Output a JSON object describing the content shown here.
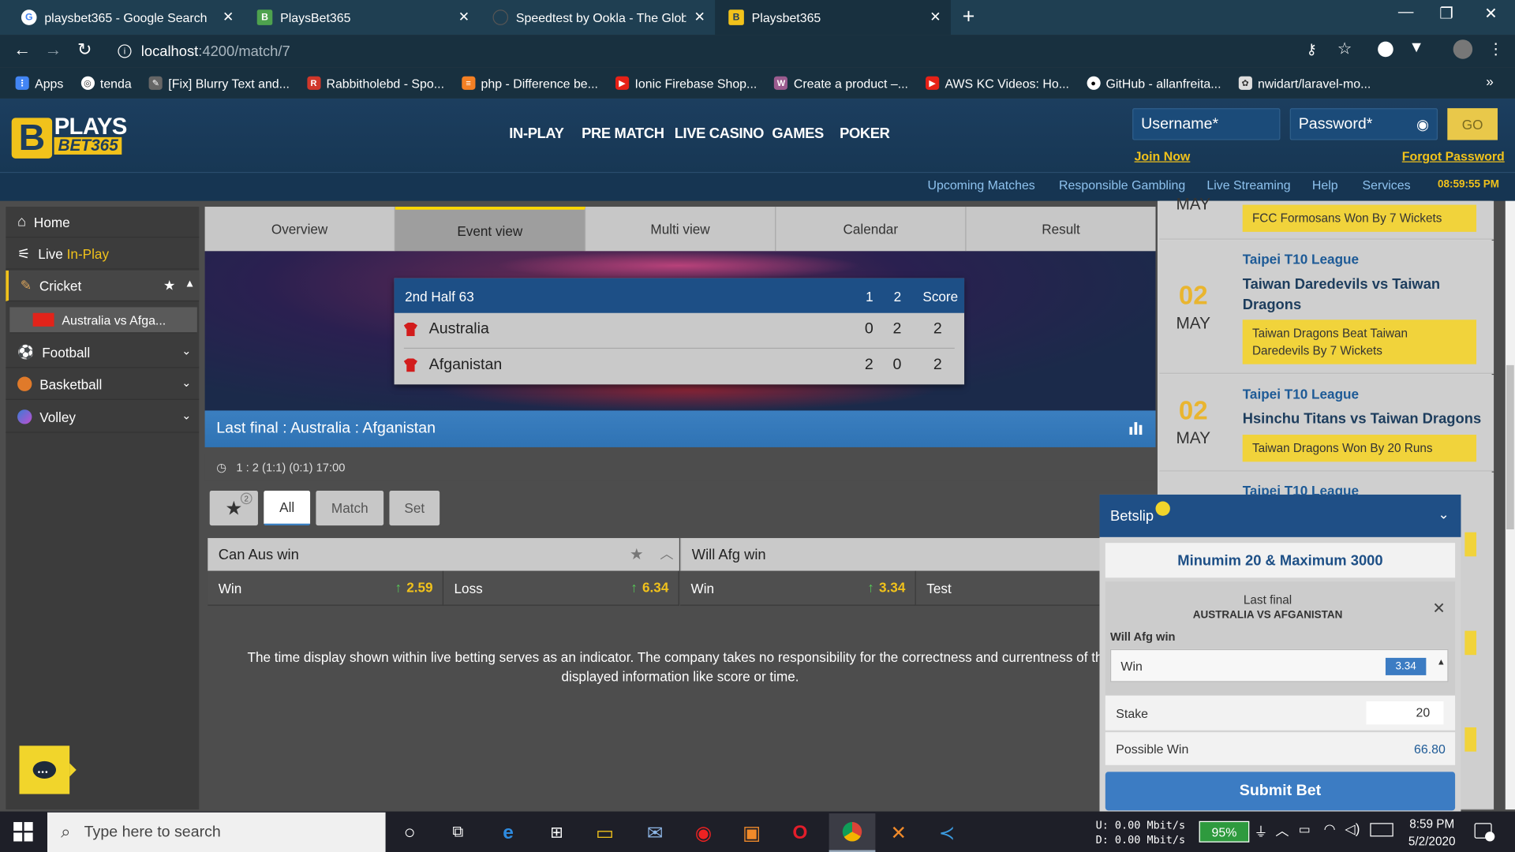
{
  "browser": {
    "tabs": [
      {
        "title": "playsbet365 - Google Search",
        "icon": "google-icon"
      },
      {
        "title": "PlaysBet365",
        "icon": "site-icon"
      },
      {
        "title": "Speedtest by Ookla - The Global",
        "icon": "speedtest-icon"
      },
      {
        "title": "Playsbet365",
        "icon": "playsbet-icon"
      }
    ],
    "url_host": "localhost",
    "url_path": ":4200/match/7",
    "bookmarks": [
      {
        "label": "Apps",
        "icon": "apps-icon"
      },
      {
        "label": "tenda",
        "icon": "globe-icon"
      },
      {
        "label": "[Fix] Blurry Text and...",
        "icon": "bookmark-icon"
      },
      {
        "label": "Rabbitholebd - Spo...",
        "icon": "bookmark-icon"
      },
      {
        "label": "php - Difference be...",
        "icon": "stackoverflow-icon"
      },
      {
        "label": "Ionic Firebase Shop...",
        "icon": "youtube-icon"
      },
      {
        "label": "Create a product –...",
        "icon": "woo-icon"
      },
      {
        "label": "AWS KC Videos: Ho...",
        "icon": "youtube-icon"
      },
      {
        "label": "GitHub - allanfreita...",
        "icon": "github-icon"
      },
      {
        "label": "nwidart/laravel-mo...",
        "icon": "bookmark-icon"
      }
    ],
    "more_bookmarks": "»"
  },
  "site": {
    "logo_top": "PLAYS",
    "logo_bottom": "BET365",
    "logo_letter": "B",
    "nav": [
      "IN-PLAY",
      "PRE MATCH",
      "LIVE CASINO",
      "GAMES",
      "POKER"
    ],
    "username_placeholder": "Username*",
    "password_placeholder": "Password*",
    "go_label": "GO",
    "join_label": "Join Now",
    "forgot_label": "Forgot Password",
    "subnav": [
      "Upcoming Matches",
      "Responsible Gambling",
      "Live Streaming",
      "Help",
      "Services"
    ],
    "clock": "08:59:55 PM"
  },
  "sidebar": {
    "home": "Home",
    "live": "Live",
    "inplay": "In-Play",
    "cricket": "Cricket",
    "match": "Australia vs Afga...",
    "football": "Football",
    "basketball": "Basketball",
    "volley": "Volley"
  },
  "main": {
    "tabs": [
      "Overview",
      "Event view",
      "Multi view",
      "Calendar",
      "Result"
    ],
    "score": {
      "period": "2nd Half 63",
      "col1": "1",
      "col2": "2",
      "col3": "Score",
      "teams": [
        {
          "name": "Australia",
          "s1": "0",
          "s2": "2",
          "total": "2"
        },
        {
          "name": "Afganistan",
          "s1": "2",
          "s2": "0",
          "total": "2"
        }
      ]
    },
    "last_final": "Last final : Australia : Afganistan",
    "info": "1 : 2 (1:1) (0:1) 17:00",
    "fav_count": "2",
    "filters": [
      "All",
      "Match",
      "Set"
    ],
    "markets": [
      {
        "title": "Can Aus win",
        "o1_label": "Win",
        "o1": "2.59",
        "o2_label": "Loss",
        "o2": "6.34"
      },
      {
        "title": "Will Afg win",
        "o1_label": "Win",
        "o1": "3.34",
        "o2_label": "Test",
        "o2": ""
      }
    ],
    "disclaimer_line1": "The time display shown within live betting serves as an indicator. The company takes no responsibility for the correctness and currentness of th",
    "disclaimer_line2": "displayed information like score or time."
  },
  "results": {
    "top_partial_month": "MAY",
    "top_result": "FCC Formosans Won By 7 Wickets",
    "cards": [
      {
        "day": "02",
        "month": "MAY",
        "league": "Taipei T10 League",
        "title": "Taiwan Daredevils vs Taiwan Dragons",
        "result": "Taiwan Dragons Beat Taiwan Daredevils By 7 Wickets"
      },
      {
        "day": "02",
        "month": "MAY",
        "league": "Taipei T10 League",
        "title": "Hsinchu Titans vs Taiwan Dragons",
        "result": "Taiwan Dragons Won By 20 Runs"
      }
    ],
    "partial_league": "Taipei T10 League"
  },
  "betslip": {
    "title": "Betslip",
    "limits": "Minumim 20 & Maximum 3000",
    "selection_event": "Last final",
    "selection_match": "AUSTRALIA VS AFGANISTAN",
    "market": "Will Afg win",
    "pick": "Win",
    "odds": "3.34",
    "stake_label": "Stake",
    "stake_value": "20",
    "possible_label": "Possible Win",
    "possible_value": "66.80",
    "submit": "Submit Bet"
  },
  "taskbar": {
    "search_placeholder": "Type here to search",
    "net_up_label": "U:",
    "net_up": "0.00 Mbit/s",
    "net_down_label": "D:",
    "net_down": "0.00 Mbit/s",
    "battery": "95%",
    "time": "8:59 PM",
    "date": "5/2/2020"
  },
  "colors": {
    "brand_blue": "#1d4f86",
    "accent_yellow": "#f1c21b",
    "odds_up": "#56c756"
  }
}
